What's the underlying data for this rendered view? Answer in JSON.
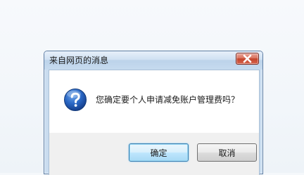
{
  "dialog": {
    "title": "来自网页的消息",
    "message": "您确定要个人申请减免账户管理费吗？",
    "buttons": {
      "ok_label": "确定",
      "cancel_label": "取消"
    }
  },
  "icons": {
    "close": "close-icon",
    "question": "question-icon"
  },
  "colors": {
    "titlebar": "#c6daef",
    "close_button": "#c3432b",
    "question_icon": "#1f5fb8",
    "default_button_glow": "#9fdcf5"
  }
}
